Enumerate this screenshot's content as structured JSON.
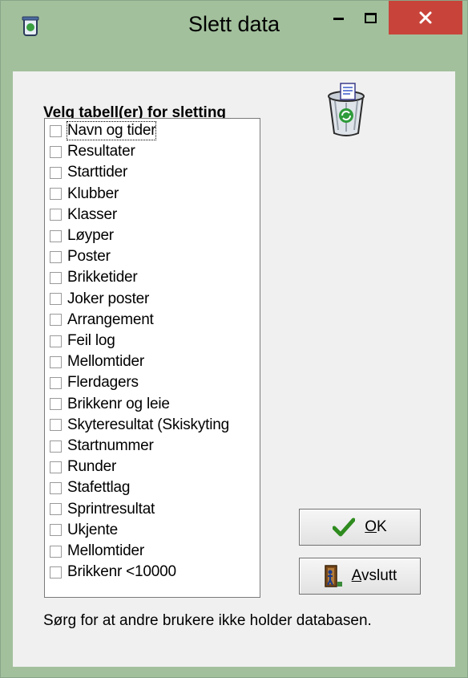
{
  "window": {
    "title": "Slett data"
  },
  "heading": "Velg tabell(er) for sletting",
  "tables": [
    {
      "label": "Navn og tider",
      "checked": false
    },
    {
      "label": "Resultater",
      "checked": false
    },
    {
      "label": "Starttider",
      "checked": false
    },
    {
      "label": "Klubber",
      "checked": false
    },
    {
      "label": "Klasser",
      "checked": false
    },
    {
      "label": "Løyper",
      "checked": false
    },
    {
      "label": "Poster",
      "checked": false
    },
    {
      "label": "Brikketider",
      "checked": false
    },
    {
      "label": "Joker poster",
      "checked": false
    },
    {
      "label": "Arrangement",
      "checked": false
    },
    {
      "label": "Feil log",
      "checked": false
    },
    {
      "label": "Mellomtider",
      "checked": false
    },
    {
      "label": "Flerdagers",
      "checked": false
    },
    {
      "label": "Brikkenr og leie",
      "checked": false
    },
    {
      "label": "Skyteresultat (Skiskyting",
      "checked": false
    },
    {
      "label": "Startnummer",
      "checked": false
    },
    {
      "label": "Runder",
      "checked": false
    },
    {
      "label": "Stafettlag",
      "checked": false
    },
    {
      "label": "Sprintresultat",
      "checked": false
    },
    {
      "label": "Ukjente",
      "checked": false
    },
    {
      "label": "Mellomtider",
      "checked": false
    },
    {
      "label": "Brikkenr <10000",
      "checked": false
    }
  ],
  "buttons": {
    "ok": {
      "mnemonic": "O",
      "rest": "K"
    },
    "exit": {
      "mnemonic": "A",
      "rest": "vslutt"
    }
  },
  "footer_note": "Sørg for at andre brukere ikke holder databasen.",
  "colors": {
    "frame": "#a2c09c",
    "close": "#c8443a",
    "dialog": "#f0f0f0",
    "ok_check": "#2e8b1e"
  }
}
